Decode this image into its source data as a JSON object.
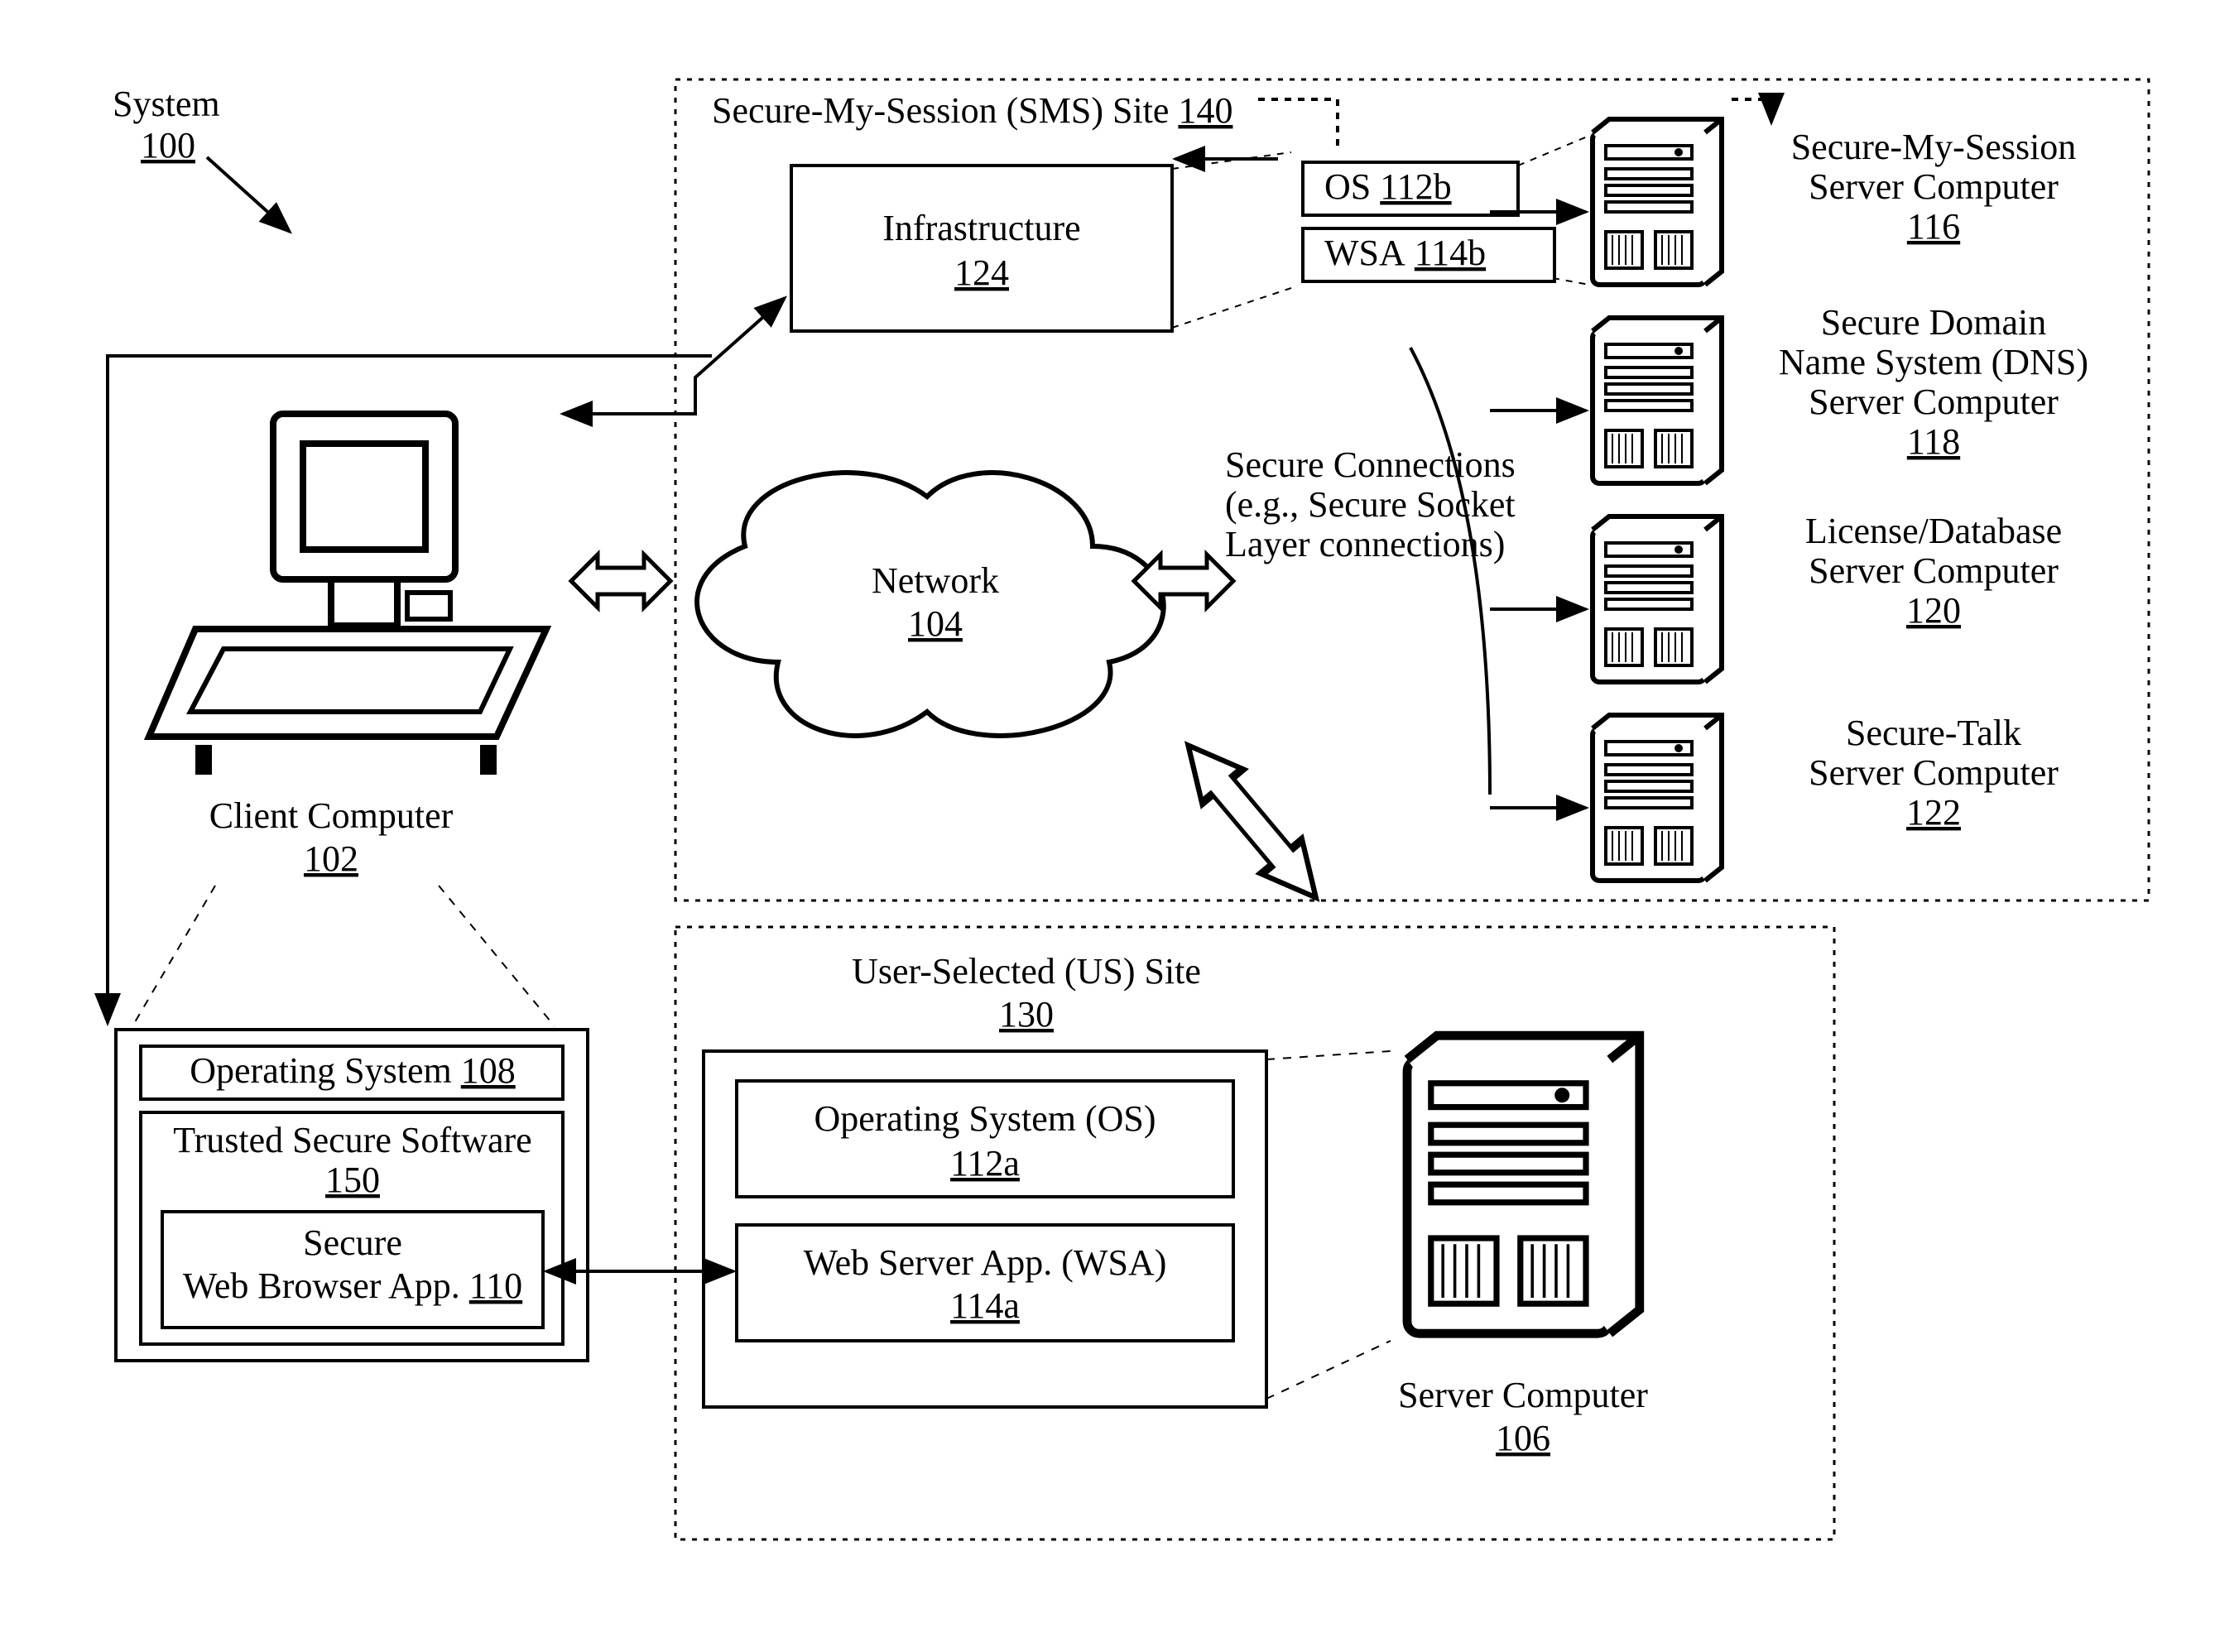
{
  "system": {
    "label": "System",
    "num": "100"
  },
  "client": {
    "label": "Client Computer",
    "num": "102",
    "os": {
      "label": "Operating System",
      "num": "108"
    },
    "tss": {
      "label": "Trusted Secure Software",
      "num": "150"
    },
    "browser": {
      "line1": "Secure",
      "line2": "Web Browser App.",
      "num": "110"
    }
  },
  "network": {
    "label": "Network",
    "num": "104"
  },
  "secure_conn": {
    "line1": "Secure Connections",
    "line2": "(e.g., Secure Socket",
    "line3": "Layer connections)"
  },
  "sms_site": {
    "label": "Secure-My-Session (SMS) Site",
    "num": "140",
    "infra": {
      "label": "Infrastructure",
      "num": "124"
    },
    "os": {
      "label": "OS",
      "num": "112b"
    },
    "wsa": {
      "label": "WSA",
      "num": "114b"
    },
    "srv1": {
      "line1": "Secure-My-Session",
      "line2": "Server Computer",
      "num": "116"
    },
    "srv2": {
      "line1": "Secure Domain",
      "line2": "Name System (DNS)",
      "line3": "Server Computer",
      "num": "118"
    },
    "srv3": {
      "line1": "License/Database",
      "line2": "Server Computer",
      "num": "120"
    },
    "srv4": {
      "line1": "Secure-Talk",
      "line2": "Server Computer",
      "num": "122"
    }
  },
  "us_site": {
    "label": "User-Selected (US) Site",
    "num": "130",
    "os": {
      "label": "Operating System (OS)",
      "num": "112a"
    },
    "wsa": {
      "label": "Web Server App.  (WSA)",
      "num": "114a"
    },
    "server": {
      "label": "Server Computer",
      "num": "106"
    }
  }
}
